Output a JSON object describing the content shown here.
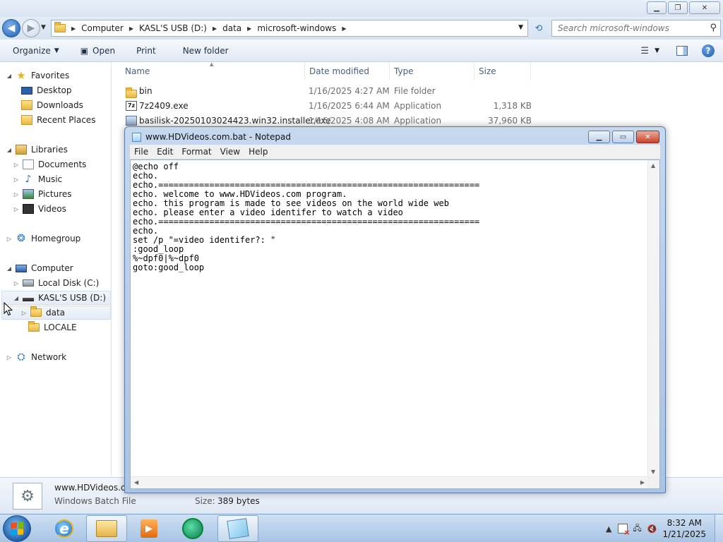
{
  "explorer": {
    "address": {
      "crumbs": [
        "Computer",
        "KASL'S USB (D:)",
        "data",
        "microsoft-windows"
      ]
    },
    "search_placeholder": "Search microsoft-windows",
    "toolbar": {
      "organize": "Organize",
      "open": "Open",
      "print": "Print",
      "new_folder": "New folder"
    },
    "nav": {
      "favorites": "Favorites",
      "desktop": "Desktop",
      "downloads": "Downloads",
      "recent_places": "Recent Places",
      "libraries": "Libraries",
      "documents": "Documents",
      "music": "Music",
      "pictures": "Pictures",
      "videos": "Videos",
      "homegroup": "Homegroup",
      "computer": "Computer",
      "local_disk": "Local Disk (C:)",
      "usb": "KASL'S USB (D:)",
      "data": "data",
      "locale": "LOCALE",
      "network": "Network"
    },
    "columns": {
      "name": "Name",
      "date_modified": "Date modified",
      "type": "Type",
      "size": "Size"
    },
    "files": [
      {
        "name": "bin",
        "date": "1/16/2025 4:27 AM",
        "type": "File folder",
        "size": ""
      },
      {
        "name": "7z2409.exe",
        "date": "1/16/2025 6:44 AM",
        "type": "Application",
        "size": "1,318 KB"
      },
      {
        "name": "basilisk-20250103024423.win32.installer.exe",
        "date": "1/16/2025 4:08 AM",
        "type": "Application",
        "size": "37,960 KB"
      }
    ],
    "details": {
      "name": "www.HDVideos.c",
      "type": "Windows Batch File",
      "size_label": "Size:",
      "size_value": "389 bytes"
    }
  },
  "notepad": {
    "title": "www.HDVideos.com.bat - Notepad",
    "menu": {
      "file": "File",
      "edit": "Edit",
      "format": "Format",
      "view": "View",
      "help": "Help"
    },
    "content": "@echo off\necho.\necho.===============================================================\necho. welcome to www.HDVideos.com program.\necho. this program is made to see videos on the world wide web\necho. please enter a video identifer to watch a video\necho.===============================================================\necho.\nset /p \"=video identifer?: \"\n:good_loop\n%~dpf0|%~dpf0\ngoto:good_loop"
  },
  "taskbar": {
    "time": "8:32 AM",
    "date": "1/21/2025"
  },
  "colors": {
    "accent": "#1f5da8",
    "titlebar": "#d9e5f3",
    "close_red": "#c8432a"
  }
}
